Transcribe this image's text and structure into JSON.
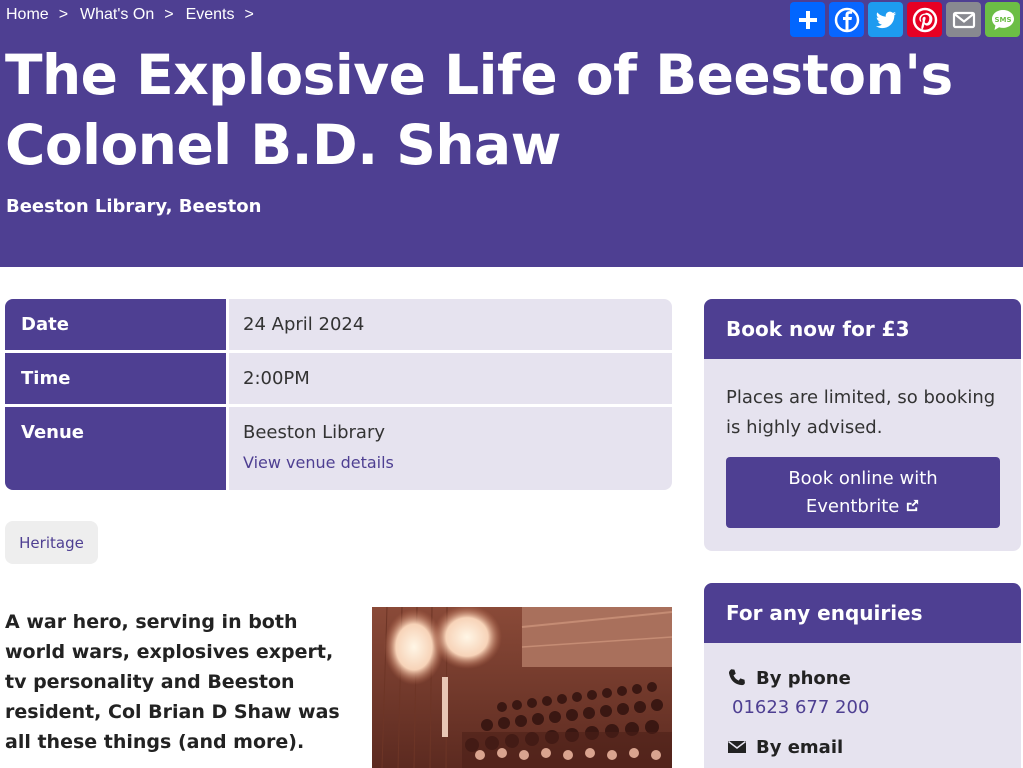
{
  "breadcrumb": [
    {
      "label": "Home",
      "sep": ">"
    },
    {
      "label": "What's On",
      "sep": ">"
    },
    {
      "label": "Events",
      "sep": ">"
    }
  ],
  "share": {
    "buttons": [
      {
        "name": "share-add-icon",
        "color": "#0166ff"
      },
      {
        "name": "facebook-icon",
        "color": "#0866ff"
      },
      {
        "name": "twitter-icon",
        "color": "#1d9bf0"
      },
      {
        "name": "pinterest-icon",
        "color": "#e60023"
      },
      {
        "name": "email-icon",
        "color": "#888990"
      },
      {
        "name": "sms-icon",
        "color": "#6cbe45"
      }
    ],
    "sms_text": "SMS"
  },
  "event": {
    "title": "The Explosive Life of Beeston's Colonel B.D. Shaw",
    "location": "Beeston Library, Beeston"
  },
  "details": {
    "date_label": "Date",
    "date_value": "24 April 2024",
    "time_label": "Time",
    "time_value": "2:00PM",
    "venue_label": "Venue",
    "venue_value": "Beeston Library",
    "venue_link": "View venue details"
  },
  "tag": "Heritage",
  "intro": "A war hero, serving in both world wars, explosives expert, tv personality and Beeston resident, Col Brian D Shaw was all these things (and more).",
  "booking": {
    "heading": "Book now for £3",
    "note": "Places are limited, so booking is highly advised.",
    "button_line1": "Book online with",
    "button_line2": "Eventbrite"
  },
  "enquiries": {
    "heading": "For any enquiries",
    "phone_label": "By phone",
    "phone_number": "01623 677 200",
    "email_label": "By email"
  },
  "colors": {
    "brand": "#4e3f92",
    "panel": "#e6e3ef"
  }
}
